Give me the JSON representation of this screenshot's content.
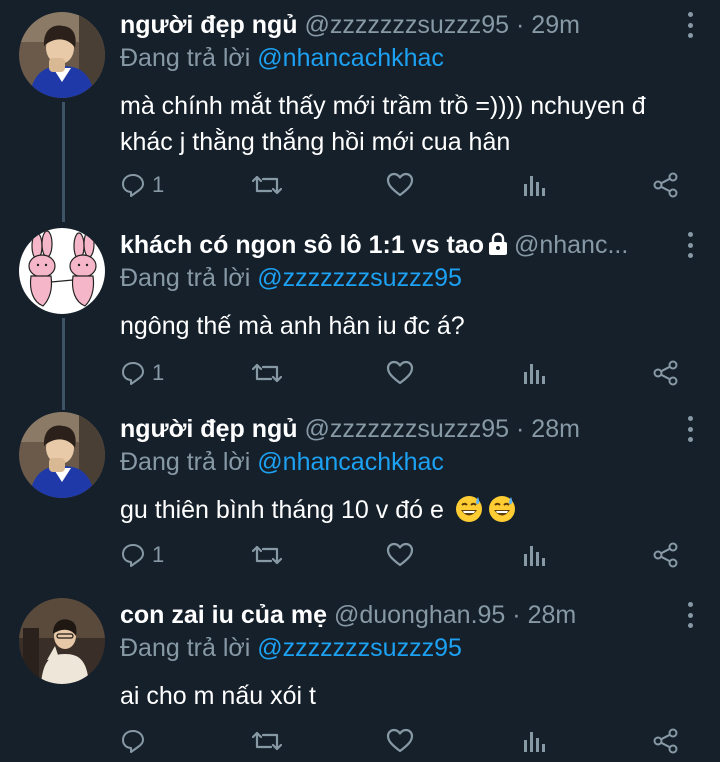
{
  "tweets": [
    {
      "name": "người đẹp ngủ",
      "handle": "@zzzzzzzsuzzz95",
      "time": "· 29m",
      "reply_prefix": "Đang trả lời",
      "reply_to": "@nhancachkhac",
      "body_lines": [
        "mà chính mắt thấy mới trầm trồ =)))) nchuyen đ",
        "khác j thằng thắng hồi mới cua hân"
      ],
      "reply_count": "1",
      "avatar": "person-blue-shirt"
    },
    {
      "name": "khách có ngon sô lô 1:1 vs tao",
      "handle": "@nhanc...",
      "time": "",
      "locked": true,
      "reply_prefix": "Đang trả lời",
      "reply_to": "@zzzzzzzsuzzz95",
      "body_lines": [
        "ngông thế mà anh hân iu đc á?"
      ],
      "reply_count": "1",
      "avatar": "pink-bunnies"
    },
    {
      "name": "người đẹp ngủ",
      "handle": "@zzzzzzzsuzzz95",
      "time": "· 28m",
      "reply_prefix": "Đang trả lời",
      "reply_to": "@nhancachkhac",
      "body_lines": [
        "gu thiên bình tháng 10 v đó e"
      ],
      "body_emoji": [
        "grinning-sweat-emoji",
        "grinning-sweat-emoji"
      ],
      "reply_count": "1",
      "avatar": "person-blue-shirt"
    },
    {
      "name": "con zai iu của mẹ",
      "handle": "@duonghan.95",
      "time": "· 28m",
      "reply_prefix": "Đang trả lời",
      "reply_to": "@zzzzzzzsuzzz95",
      "body_lines": [
        "ai cho m nấu xói t"
      ],
      "reply_count": "",
      "avatar": "person-white-sweater"
    }
  ],
  "icons": {
    "reply": "reply-icon",
    "retweet": "retweet-icon",
    "like": "heart-icon",
    "stats": "stats-icon",
    "share": "share-icon",
    "more": "more-vertical-icon",
    "lock": "lock-icon"
  },
  "colors": {
    "background": "#15202b",
    "secondary_text": "#8899a6",
    "mention": "#1da1f2",
    "thread_line": "#3d5466"
  }
}
